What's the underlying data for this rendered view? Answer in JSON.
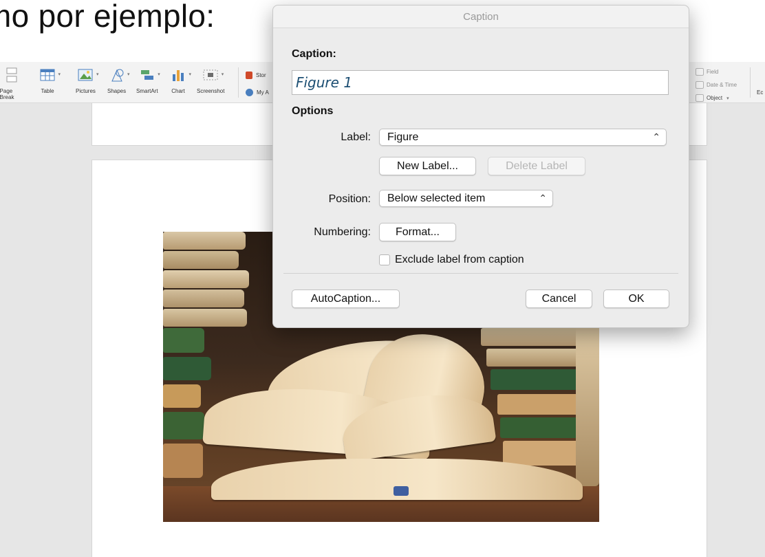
{
  "slide": {
    "heading": "mo por ejemplo:"
  },
  "ribbon": {
    "buttons": [
      {
        "label": "Page\nBreak",
        "icon": "page-break-icon"
      },
      {
        "label": "Table",
        "icon": "table-icon"
      },
      {
        "label": "Pictures",
        "icon": "pictures-icon"
      },
      {
        "label": "Shapes",
        "icon": "shapes-icon"
      },
      {
        "label": "SmartArt",
        "icon": "smartart-icon"
      },
      {
        "label": "Chart",
        "icon": "chart-icon"
      },
      {
        "label": "Screenshot",
        "icon": "screenshot-icon"
      }
    ],
    "addins": {
      "store": "Stor",
      "my": "My A"
    },
    "right": {
      "field": "Field",
      "date_time": "Date & Time",
      "object": "Object",
      "cut": "Ec"
    }
  },
  "dialog": {
    "title": "Caption",
    "caption_label": "Caption:",
    "caption_value": "Figure 1",
    "options_label": "Options",
    "label_label": "Label:",
    "label_value": "Figure",
    "new_label_button": "New Label...",
    "delete_label_button": "Delete Label",
    "position_label": "Position:",
    "position_value": "Below selected item",
    "numbering_label": "Numbering:",
    "format_button": "Format...",
    "exclude_checkbox_label": "Exclude label from caption",
    "exclude_checked": false,
    "autocaption_button": "AutoCaption...",
    "cancel_button": "Cancel",
    "ok_button": "OK"
  }
}
